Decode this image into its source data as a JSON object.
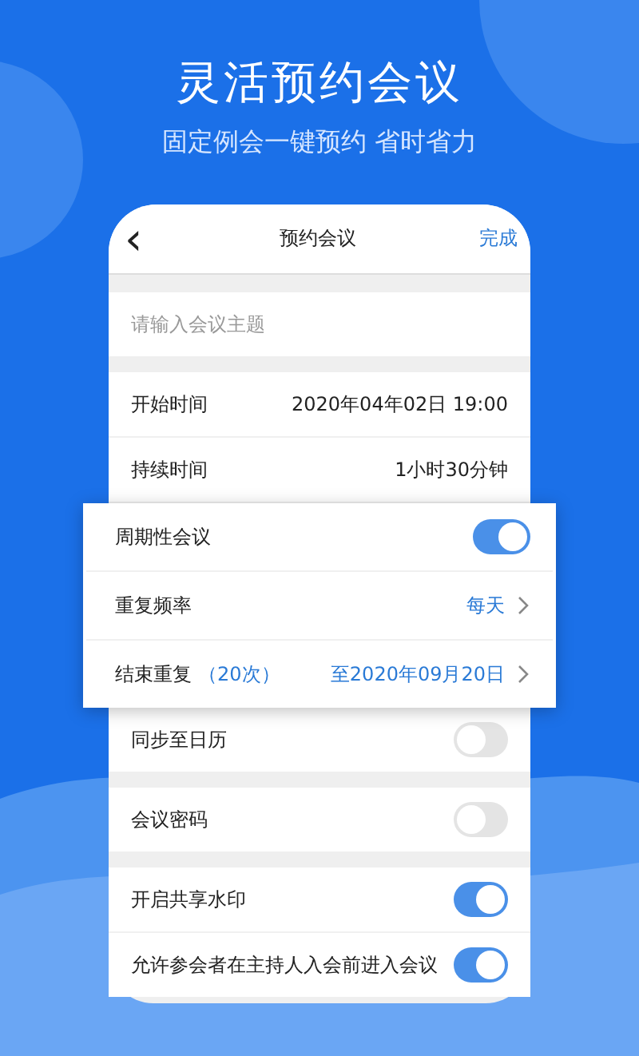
{
  "headline": "灵活预约会议",
  "tagline": "固定例会一键预约 省时省力",
  "nav": {
    "back": "‹",
    "title": "预约会议",
    "action": "完成"
  },
  "subject": {
    "placeholder": "请输入会议主题"
  },
  "groups": [
    {
      "raised": false,
      "rows": [
        {
          "kind": "value",
          "label": "开始时间",
          "value": "2020年04年02日 19:00"
        },
        {
          "kind": "value",
          "label": "持续时间",
          "value": "1小时30分钟"
        }
      ]
    },
    {
      "raised": true,
      "rows": [
        {
          "kind": "toggle",
          "label": "周期性会议",
          "on": true
        },
        {
          "kind": "link",
          "label": "重复频率",
          "value": "每天"
        },
        {
          "kind": "link",
          "label": "结束重复",
          "note": "（20次）",
          "value": "至2020年09月20日"
        }
      ]
    },
    {
      "raised": false,
      "rows": [
        {
          "kind": "toggle",
          "label": "同步至日历",
          "on": false
        }
      ]
    },
    {
      "raised": false,
      "rows": [
        {
          "kind": "toggle",
          "label": "会议密码",
          "on": false
        }
      ]
    },
    {
      "raised": false,
      "rows": [
        {
          "kind": "toggle",
          "label": "开启共享水印",
          "on": true
        },
        {
          "kind": "toggle",
          "label": "允许参会者在主持人入会前进入会议",
          "on": true
        }
      ]
    }
  ]
}
